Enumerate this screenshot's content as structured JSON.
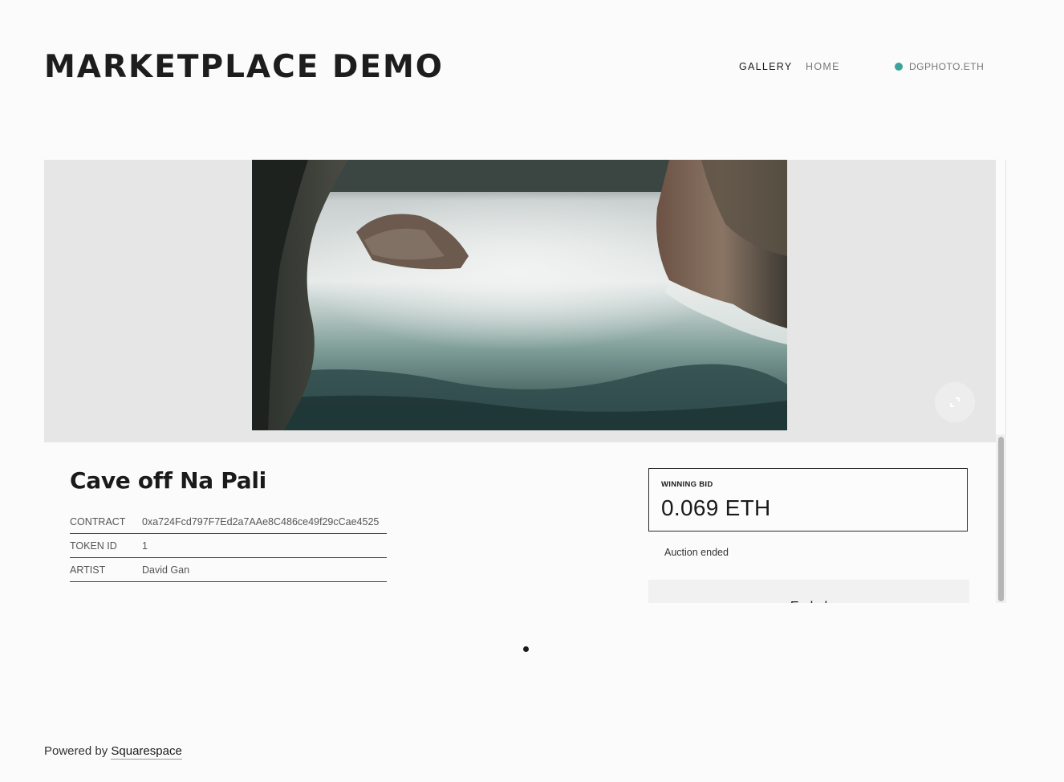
{
  "header": {
    "site_title": "MARKETPLACE DEMO",
    "nav": {
      "gallery": "GALLERY",
      "home": "HOME"
    },
    "wallet": {
      "label": "DGPHOTO.ETH",
      "status_color": "#3aa39b"
    }
  },
  "nft": {
    "image_alt": "Cave off Na Pali",
    "title": "Cave off Na Pali",
    "meta": [
      {
        "key": "CONTRACT",
        "value": "0xa724Fcd797F7Ed2a7AAe8C486ce49f29cCae4525"
      },
      {
        "key": "TOKEN ID",
        "value": "1"
      },
      {
        "key": "ARTIST",
        "value": "David Gan"
      }
    ]
  },
  "auction": {
    "winning_bid_label": "WINNING BID",
    "winning_bid_value": "0.069 ETH",
    "status": "Auction ended",
    "button_label": "Ended"
  },
  "footer": {
    "prefix": "Powered by ",
    "link": "Squarespace"
  },
  "icons": {
    "fullscreen": "fullscreen-icon",
    "wallet_status": "status-dot-icon"
  }
}
